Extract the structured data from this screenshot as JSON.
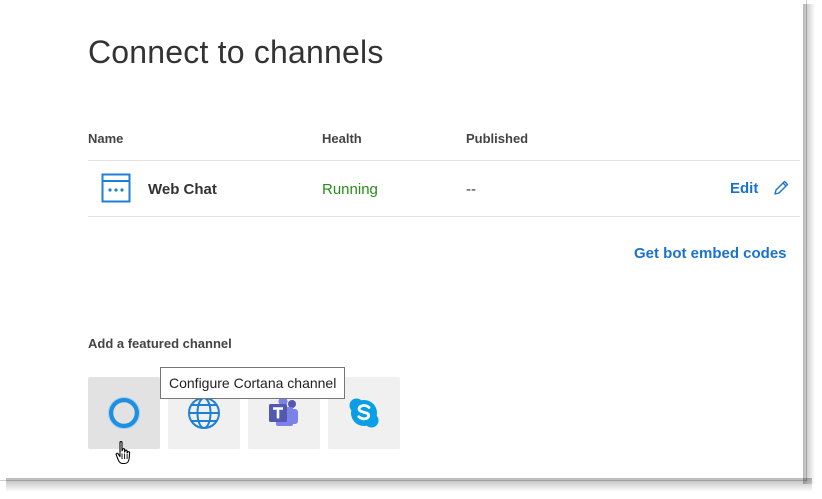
{
  "page": {
    "title": "Connect to channels"
  },
  "table": {
    "headers": {
      "name": "Name",
      "health": "Health",
      "published": "Published"
    },
    "rows": [
      {
        "icon": "web-chat-icon",
        "name": "Web Chat",
        "health": "Running",
        "published": "--",
        "edit_label": "Edit"
      }
    ],
    "embed_link": "Get bot embed codes"
  },
  "featured": {
    "heading": "Add a featured channel",
    "channels": [
      {
        "name": "Cortana",
        "icon": "cortana-icon"
      },
      {
        "name": "Web",
        "icon": "globe-icon"
      },
      {
        "name": "Microsoft Teams",
        "icon": "teams-icon"
      },
      {
        "name": "Skype",
        "icon": "skype-icon"
      }
    ],
    "tooltip": "Configure Cortana channel"
  },
  "colors": {
    "link": "#1a73c9",
    "running": "#2a8a1b",
    "cortana": "#1e8fe0",
    "teams": "#5558af",
    "skype": "#0a9ee6"
  }
}
